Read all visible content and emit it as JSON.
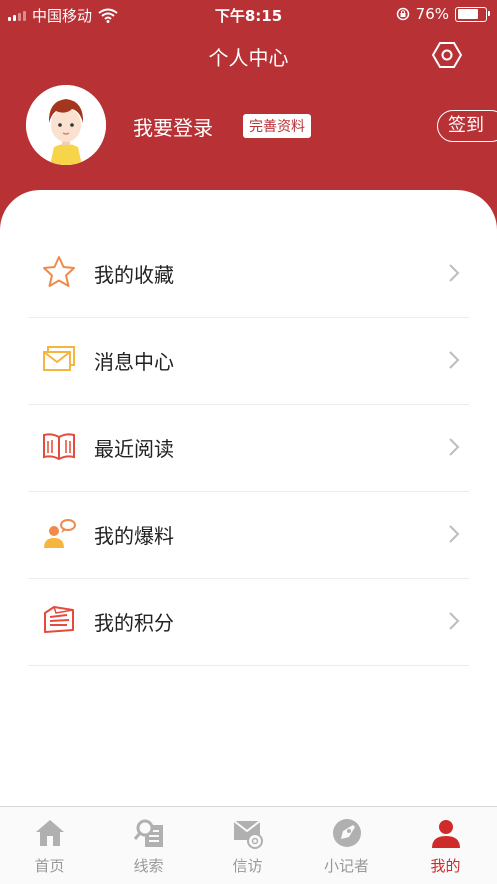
{
  "status": {
    "carrier": "中国移动",
    "time": "下午8:15",
    "battery": "76%"
  },
  "header": {
    "title": "个人中心",
    "login_label": "我要登录",
    "complete_profile_label": "完善资料",
    "checkin_label": "签到"
  },
  "menu": [
    {
      "label": "我的收藏",
      "icon": "star-icon"
    },
    {
      "label": "消息中心",
      "icon": "envelope-icon"
    },
    {
      "label": "最近阅读",
      "icon": "book-icon"
    },
    {
      "label": "我的爆料",
      "icon": "user-chat-icon"
    },
    {
      "label": "我的积分",
      "icon": "points-icon"
    }
  ],
  "tabs": [
    {
      "label": "首页",
      "icon": "home-icon"
    },
    {
      "label": "线索",
      "icon": "search-doc-icon"
    },
    {
      "label": "信访",
      "icon": "mail-at-icon"
    },
    {
      "label": "小记者",
      "icon": "rocket-icon"
    },
    {
      "label": "我的",
      "icon": "user-icon",
      "active": true
    }
  ],
  "colors": {
    "brand": "#b83135",
    "active_tab": "#d02b2b",
    "inactive_tab": "#999999",
    "icon_orange": "#f08a4b"
  }
}
